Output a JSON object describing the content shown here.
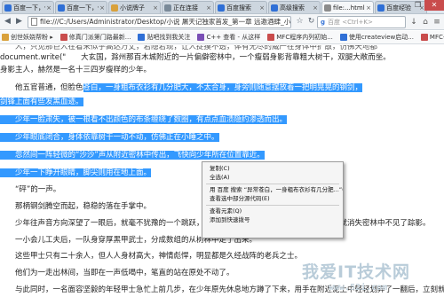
{
  "browser": {
    "tabs": [
      {
        "label": "百度一下，你",
        "active": false,
        "favicon_color": "#2f6fd6"
      },
      {
        "label": "百度一下，你",
        "active": false,
        "favicon_color": "#2f6fd6"
      },
      {
        "label": "小说牌子",
        "active": false,
        "favicon_color": "#d9a13b"
      },
      {
        "label": "正在连接",
        "active": false,
        "favicon_color": "#7a8a99"
      },
      {
        "label": "百度搜索",
        "active": false,
        "favicon_color": "#2f6fd6"
      },
      {
        "label": "高级搜索",
        "active": false,
        "favicon_color": "#2f6fd6"
      },
      {
        "label": "file:...html",
        "active": true,
        "favicon_color": "#8c8c8c"
      },
      {
        "label": "百度经验",
        "active": false,
        "favicon_color": "#2f6fd6"
      }
    ],
    "new_tab_glyph": "+",
    "window_controls": [
      "–",
      "❐",
      "✕"
    ],
    "address": "file:///C:/Users/Administrator/Desktop/小说 屠天记独家首发_第一章 远邀酒肆_小说_起点中文小说网_小说",
    "search_engine_glyph": "g",
    "search_placeholder": "百度 <Ctrl+K>",
    "nav_glyphs": {
      "back": "◀",
      "forward": "▶",
      "refresh": "↻",
      "star": "☆",
      "download": "↓",
      "home": "⌂",
      "menu": "≡"
    }
  },
  "bookmarks": [
    {
      "label": "创世妖娆帮粉 ▸",
      "color": "#d9a13b"
    },
    {
      "label": "修真门派第门路最新...",
      "color": "#c94c4c"
    },
    {
      "label": "贴吧找到我关注",
      "color": "#2f6fd6"
    },
    {
      "label": "C++ 查看 - 从这样",
      "color": "#7a4fb5"
    },
    {
      "label": "MFC程序内列初始...",
      "color": "#c94c4c"
    },
    {
      "label": "使用createview启动...",
      "color": "#2f6fd6"
    },
    {
      "label": "MFC-一种查显示",
      "color": "#c94c4c"
    }
  ],
  "content": {
    "lines": [
      {
        "text": "　　人，只见那巨人在看来似乎高达万丈，若隐若现，让人捉摸不透，体有无尽的威严在身体中扩散，仿佛天地都",
        "hl": false
      },
      {
        "text": "document.write(\"　　大玄国，滁州那百木城附近的一片偏僻密林中，一个瘦弱身影背靠粗大树干，双腿大敞而坐。",
        "hl": false
      },
      {
        "text": "身影主人，赫然是一名十三四岁瘦样的少年。",
        "hl": false
      },
      {
        "text": "　　他五官普通，但脸色苍白，一身粗布衣衫有几分肥大，不太合身，身旁则随意摆放着一把明晃晃的钢剑，",
        "hl": true
      },
      {
        "text": "剑锋上面有些发黑血迹。",
        "hl": true
      },
      {
        "text": "　　少年一脸肃失，被一根看不出颜色的布条缠绕了数圈，有点点血渍隐约渗透而出。",
        "hl": true
      },
      {
        "text": "　　少年眼底闭合，身体依靠树干一动不动，仿佛正在小睡之中。",
        "hl": true
      },
      {
        "text": "　　忽然间一阵轻微的“沙沙”声从附近密林中传出，飞快向少年所在位置靠近。",
        "hl": true
      },
      {
        "text": "　　少年一下睁开眼睛，脚尖则用在地上面。",
        "hl": true
      },
      {
        "text": "　　“砰”的一声。",
        "hl": false
      },
      {
        "text": "　　那柄钢剑腾空而起，稳稳的落在手掌中。",
        "hl": false
      },
      {
        "text": "　　少年往声音方向深望了一眼后，就毫不犹豫的一个跳跃，向右侧林木方向疾奔而去，几个闪动后，就消失密林中不见了踪影。",
        "hl": false
      },
      {
        "text": "　　一小会儿工夫后，一队身穿厚黑甲武士，分成数组的从树林中走了出来。",
        "hl": false
      },
      {
        "text": "　　这些甲士只有二十余人，但人人身材高大，神情彪悍，明显都是久经战阵的老兵之士。",
        "hl": false
      },
      {
        "text": "　　他们为一走出林间，当即在一声低喝中，笔直的站在原处不动了。",
        "hl": false
      },
      {
        "text": "　　与此同时，一名面容坚毅的年轻甲士急忙上前几步，在少年原先休息地方蹲了下来，用手在附近泥土中轻轻划弄了一翻后，立刻就起",
        "hl": false
      }
    ]
  },
  "context_menu": {
    "items": [
      {
        "label": "复制(C)",
        "type": "item"
      },
      {
        "label": "全选(A)",
        "type": "item"
      },
      {
        "label": "",
        "type": "separator"
      },
      {
        "label": "用 百度 搜索 “异常苍白，一身粗布衣衫有几分肥...”(S)",
        "type": "item"
      },
      {
        "label": "查看选中部分源代码(E)",
        "type": "item"
      },
      {
        "label": "",
        "type": "separator"
      },
      {
        "label": "查看元素(Q)",
        "type": "item"
      },
      {
        "label": "添加到快速拨号",
        "type": "item"
      }
    ]
  },
  "watermark": {
    "main": "我爱IT技术网",
    "sub": "www.52i.com"
  }
}
